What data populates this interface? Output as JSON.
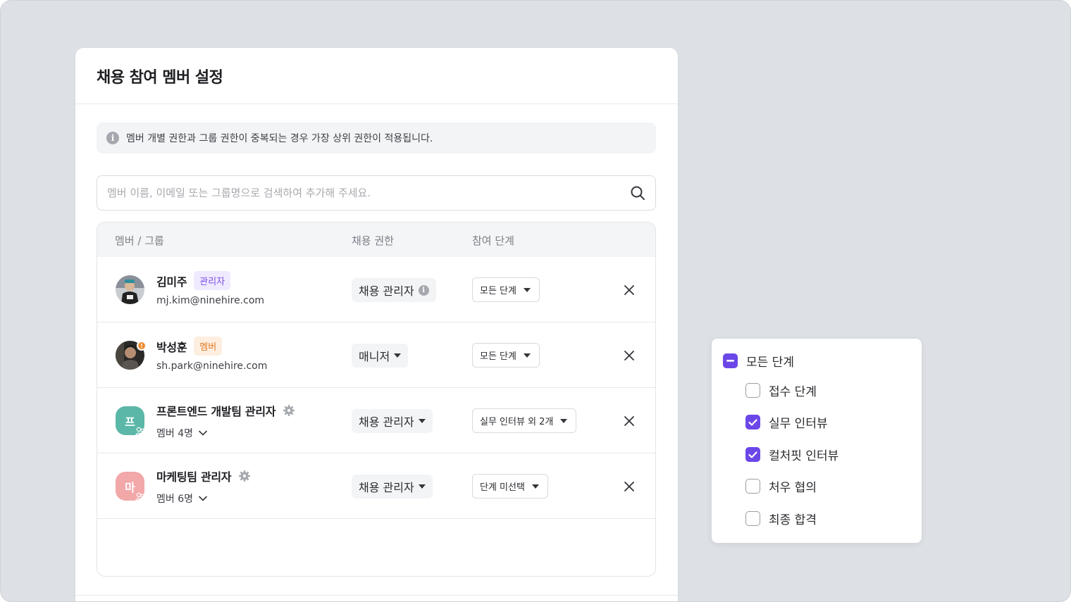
{
  "modal": {
    "title": "채용 참여 멤버 설정",
    "notice": "멤버 개별 권한과 그룹 권한이 중복되는 경우 가장 상위 권한이 적용됩니다.",
    "search_placeholder": "멤버 이름, 이메일 또는 그룹명으로 검색하여 추가해 주세요."
  },
  "table": {
    "headers": {
      "member": "멤버 / 그룹",
      "role": "채용 권한",
      "stage": "참여 단계"
    },
    "rows": [
      {
        "name": "김미주",
        "badge": "관리자",
        "sub": "mj.kim@ninehire.com",
        "role": "채용 관리자",
        "stage": "모든 단계"
      },
      {
        "name": "박성훈",
        "badge": "멤버",
        "sub": "sh.park@ninehire.com",
        "role": "매니저",
        "stage": "모든 단계"
      },
      {
        "name": "프론트엔드 개발팀 관리자",
        "avatar_letter": "프",
        "avatar_color": "#5bb7a7",
        "sub": "멤버 4명",
        "role": "채용 관리자",
        "stage": "실무 인터뷰 외 2개"
      },
      {
        "name": "마케팅팀 관리자",
        "avatar_letter": "마",
        "avatar_color": "#f2a7a8",
        "sub": "멤버 6명",
        "role": "채용 관리자",
        "stage": "단계 미선택"
      }
    ]
  },
  "dropdown": {
    "all": {
      "label": "모든 단계",
      "state": "partial"
    },
    "options": [
      {
        "label": "접수 단계",
        "checked": false
      },
      {
        "label": "실무 인터뷰",
        "checked": true
      },
      {
        "label": "컬처핏 인터뷰",
        "checked": true
      },
      {
        "label": "처우 협의",
        "checked": false
      },
      {
        "label": "최종 합격",
        "checked": false
      }
    ]
  },
  "colors": {
    "accent": "#6b47e8",
    "admin_badge": "#7b4fe6",
    "member_badge": "#e07b28",
    "background": "#dde0e5"
  }
}
